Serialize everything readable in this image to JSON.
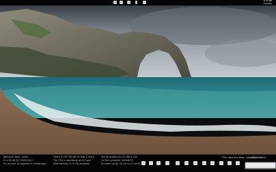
{
  "topbar": {
    "icons": [
      "grid-icon",
      "dots-icon",
      "car-icon",
      "bar-icon",
      "gear-icon"
    ],
    "clock": {
      "line1": "6:45 PM",
      "line2": "Tuesday"
    }
  },
  "wallpaper": {
    "subject": "Durdle Door sea arch, Dorset coast"
  },
  "info_left": {
    "line1": "Welcome back, Julian",
    "line2": "It is 06:48:33 10/02/2011",
    "line3": "It's around 14 degrees in Cambridge"
  },
  "info_mid1": {
    "line1": "There is 207 GB left on Mac 0 drive",
    "line2": "The CPU is operating at 4% load",
    "line3": "RAM Memory 3.73 GB available"
  },
  "info_mid2": {
    "line1": "You're located on 10.166.0.144",
    "line2": "On the computer JULIAN-PC",
    "line3": "It's been up for 0h 26 m 22 hours"
  },
  "now_playing": {
    "text": "7750: Nina Enri Rods - About Like a Hole"
  },
  "media": {
    "text": "1:48 / 3:33"
  },
  "dock": {
    "icons": [
      "star-icon",
      "wrench-icon",
      "grid-icon",
      "list-icon",
      "folder-icon",
      "image-icon",
      "folder-icon",
      "music-icon",
      "list-icon",
      "power-icon",
      "refresh-icon",
      "loop-icon"
    ]
  },
  "search": {
    "placeholder": ""
  }
}
